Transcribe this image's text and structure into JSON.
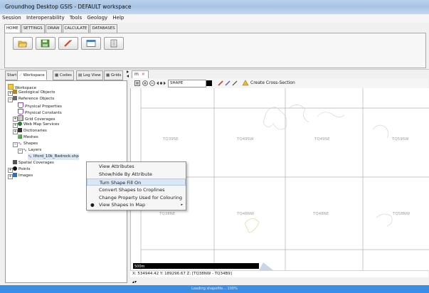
{
  "window": {
    "title": "Groundhog Desktop GSIS - DEFAULT workspace"
  },
  "menu": [
    "Session",
    "Interoperability",
    "Tools",
    "Geology",
    "Help"
  ],
  "ribbon_tabs": [
    "HOME",
    "SETTINGS",
    "DRAW",
    "CALCULATE",
    "DATABASES"
  ],
  "ribbon_buttons": [
    {
      "icon": "folder-open-icon"
    },
    {
      "icon": "save-icon"
    },
    {
      "icon": "draw-icon"
    },
    {
      "icon": "window-icon"
    },
    {
      "icon": "building-icon"
    }
  ],
  "left_tabs": [
    "Start",
    "Workspace",
    "Codes",
    "Log View",
    "Grids"
  ],
  "tree": [
    {
      "label": "Workspace",
      "icon": "folder-icon",
      "color": "#f5c842"
    },
    {
      "label": "Geological Objects",
      "icon": "layers-icon",
      "color": "#b5852a"
    },
    {
      "label": "Reference Objects",
      "icon": "book-icon",
      "color": "#6a6a6a"
    },
    {
      "label": "Physical Properties",
      "icon": "flask-icon",
      "color": "#8c44b8"
    },
    {
      "label": "Physical Constants",
      "icon": "flask-icon",
      "color": "#8c44b8"
    },
    {
      "label": "Grid Coverages",
      "icon": "grid-icon",
      "color": "#777777"
    },
    {
      "label": "Web Map Services",
      "icon": "globe-icon",
      "color": "#2b7a2b"
    },
    {
      "label": "Dictionaries",
      "icon": "dictionary-icon",
      "color": "#333333"
    },
    {
      "label": "Meshes",
      "icon": "mesh-icon",
      "color": "#3a9c3a"
    },
    {
      "label": "Shapes",
      "icon": "shape-icon",
      "color": "#7a4fa0"
    },
    {
      "label": "Layers",
      "icon": "shape-icon",
      "color": "#7a4fa0"
    },
    {
      "label": "Ilford_10k_Bedrock.shp",
      "icon": "shapefile-icon",
      "color": "#7a4fa0"
    },
    {
      "label": "Spatial Coverages",
      "icon": "coverage-icon",
      "color": "#555555"
    },
    {
      "label": "Points",
      "icon": "points-icon",
      "color": "#111111"
    },
    {
      "label": "Images",
      "icon": "image-icon",
      "color": "#2f6fb5"
    }
  ],
  "context_menu": [
    {
      "label": "View Attributes",
      "highlight": false,
      "submenu": false
    },
    {
      "label": "Show/hide By Attribute",
      "highlight": false,
      "submenu": false
    },
    {
      "label": "Turn Shape Fill On",
      "highlight": true,
      "submenu": false
    },
    {
      "label": "Convert Shapes to Croplines",
      "highlight": false,
      "submenu": false
    },
    {
      "label": "Change Property Used for Colouring",
      "highlight": false,
      "submenu": false
    },
    {
      "label": "View Shapes In Map",
      "highlight": false,
      "submenu": true
    }
  ],
  "map": {
    "tab_label": "m",
    "shape_select": "SHAPE",
    "create_cross_section": "Create Cross-Section",
    "grid_labels_top": [
      "TQ39SE",
      "TQ49SW",
      "TQ49SE",
      "TQ59SW"
    ],
    "grid_labels_bottom": [
      "TQ38NE",
      "TQ48NW",
      "TQ48NE",
      "TQ58NW"
    ],
    "scale_label": "500m"
  },
  "status": {
    "coords": "X: 534944.42 Y: 189296.67 Z:  [TQ38NW - TQ34B9]",
    "progress_text": "Loading shapefile... 100%"
  }
}
